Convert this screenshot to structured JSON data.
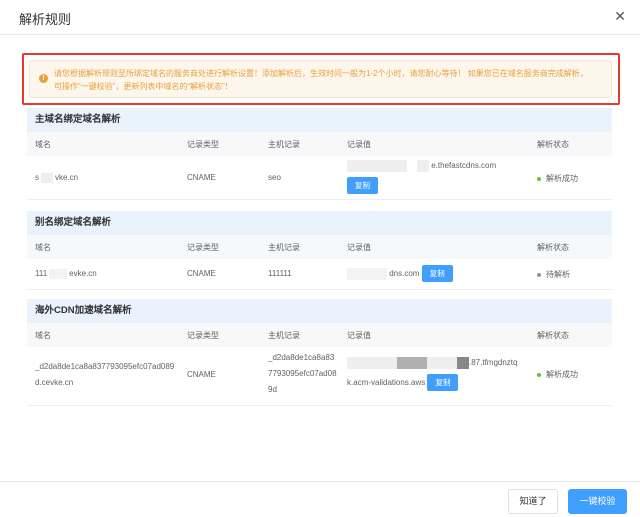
{
  "dialog": {
    "title": "解析规则",
    "close_icon": "close-icon"
  },
  "alert": {
    "text": "请您根据解析规则至所绑定域名的服务商处进行解析设置！添加解析后，生效时间一般为1-2个小时，请您耐心等待！ 如果您已在域名服务商完成解析，可操作“一键校验”，更新列表中域名的“解析状态”！",
    "icon": "warning-icon"
  },
  "columns": {
    "domain": "域名",
    "type": "记录类型",
    "host": "主机记录",
    "value": "记录值",
    "status": "解析状态"
  },
  "copy_label": "复制",
  "colors": {
    "success": "#67c23a",
    "pending": "#909399",
    "primary": "#409eff",
    "warning": "#e6a23c"
  },
  "sections": [
    {
      "title": "主域名绑定域名解析",
      "row": {
        "domain_a": "s",
        "domain_b": "vke.cn",
        "type": "CNAME",
        "host": "seo",
        "value": "e.thefastcdns.com",
        "status": "解析成功"
      }
    },
    {
      "title": "别名绑定域名解析",
      "row": {
        "domain_a": "111",
        "domain_b": "evke.cn",
        "type": "CNAME",
        "host": "111111",
        "value": "dns.com",
        "status": "待解析"
      }
    },
    {
      "title": "海外CDN加速域名解析",
      "row": {
        "domain_a": "_d2da8de1ca8a837793095efc07ad089",
        "domain_b": "d.cevke.cn",
        "type": "CNAME",
        "host_a": "_d2da8de1ca8a83",
        "host_b": "7793095efc07ad08",
        "host_c": "9d",
        "value_a": ".87.tfmgdnztq",
        "value_b": "k.acm-validations.aws",
        "status": "解析成功"
      }
    }
  ],
  "footer": {
    "ok_label": "知道了",
    "verify_label": "一键校验"
  }
}
